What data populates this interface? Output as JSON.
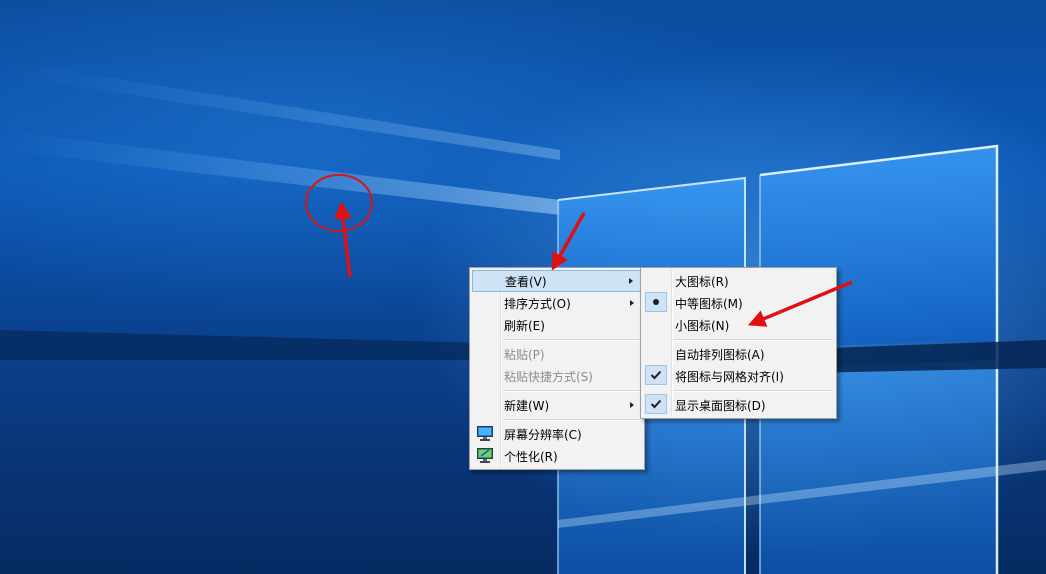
{
  "desktop": {
    "accent": "#0a56b4"
  },
  "context_menu": {
    "items": [
      {
        "label": "查看(V)",
        "submenu": true,
        "highlighted": true
      },
      {
        "label": "排序方式(O)",
        "submenu": true
      },
      {
        "label": "刷新(E)"
      },
      {
        "label": "粘贴(P)",
        "disabled": true
      },
      {
        "label": "粘贴快捷方式(S)",
        "disabled": true
      },
      {
        "label": "新建(W)",
        "submenu": true
      },
      {
        "label": "屏幕分辨率(C)",
        "icon": "display-settings-icon"
      },
      {
        "label": "个性化(R)",
        "icon": "personalize-icon"
      }
    ]
  },
  "view_submenu": {
    "items": [
      {
        "label": "大图标(R)"
      },
      {
        "label": "中等图标(M)",
        "selected": true
      },
      {
        "label": "小图标(N)"
      },
      {
        "label": "自动排列图标(A)"
      },
      {
        "label": "将图标与网格对齐(I)",
        "checked": true
      },
      {
        "label": "显示桌面图标(D)",
        "checked": true
      }
    ]
  },
  "annotations": {
    "color": "#e01010"
  }
}
